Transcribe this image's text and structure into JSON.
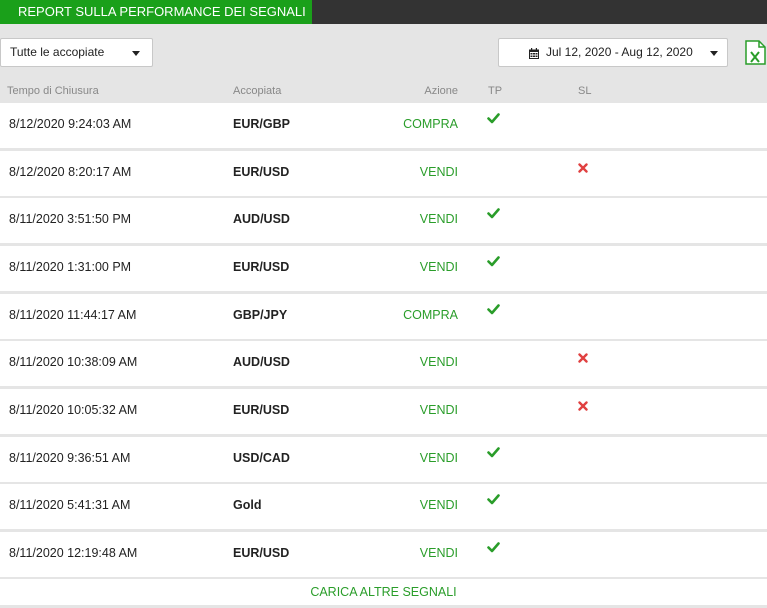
{
  "header": {
    "title": "REPORT SULLA PERFORMANCE DEI SEGNALI"
  },
  "colors": {
    "accent": "#1aa01a",
    "action_text": "#2a9d2a",
    "sl_mark": "#e04040",
    "topbar": "#333333"
  },
  "filters": {
    "pair_select": "Tutte le accopiate",
    "date_range": "Jul 12, 2020 - Aug 12, 2020"
  },
  "columns": {
    "time": "Tempo di Chiusura",
    "pair": "Accopiata",
    "action": "Azione",
    "tp": "TP",
    "sl": "SL"
  },
  "rows": [
    {
      "time": "8/12/2020 9:24:03 AM",
      "pair": "EUR/GBP",
      "action": "COMPRA",
      "result": "tp"
    },
    {
      "time": "8/12/2020 8:20:17 AM",
      "pair": "EUR/USD",
      "action": "VENDI",
      "result": "sl"
    },
    {
      "time": "8/11/2020 3:51:50 PM",
      "pair": "AUD/USD",
      "action": "VENDI",
      "result": "tp"
    },
    {
      "time": "8/11/2020 1:31:00 PM",
      "pair": "EUR/USD",
      "action": "VENDI",
      "result": "tp"
    },
    {
      "time": "8/11/2020 11:44:17 AM",
      "pair": "GBP/JPY",
      "action": "COMPRA",
      "result": "tp"
    },
    {
      "time": "8/11/2020 10:38:09 AM",
      "pair": "AUD/USD",
      "action": "VENDI",
      "result": "sl"
    },
    {
      "time": "8/11/2020 10:05:32 AM",
      "pair": "EUR/USD",
      "action": "VENDI",
      "result": "sl"
    },
    {
      "time": "8/11/2020 9:36:51 AM",
      "pair": "USD/CAD",
      "action": "VENDI",
      "result": "tp"
    },
    {
      "time": "8/11/2020 5:41:31 AM",
      "pair": "Gold",
      "action": "VENDI",
      "result": "tp"
    },
    {
      "time": "8/11/2020 12:19:48 AM",
      "pair": "EUR/USD",
      "action": "VENDI",
      "result": "tp"
    }
  ],
  "load_more": "CARICA ALTRE SEGNALI"
}
